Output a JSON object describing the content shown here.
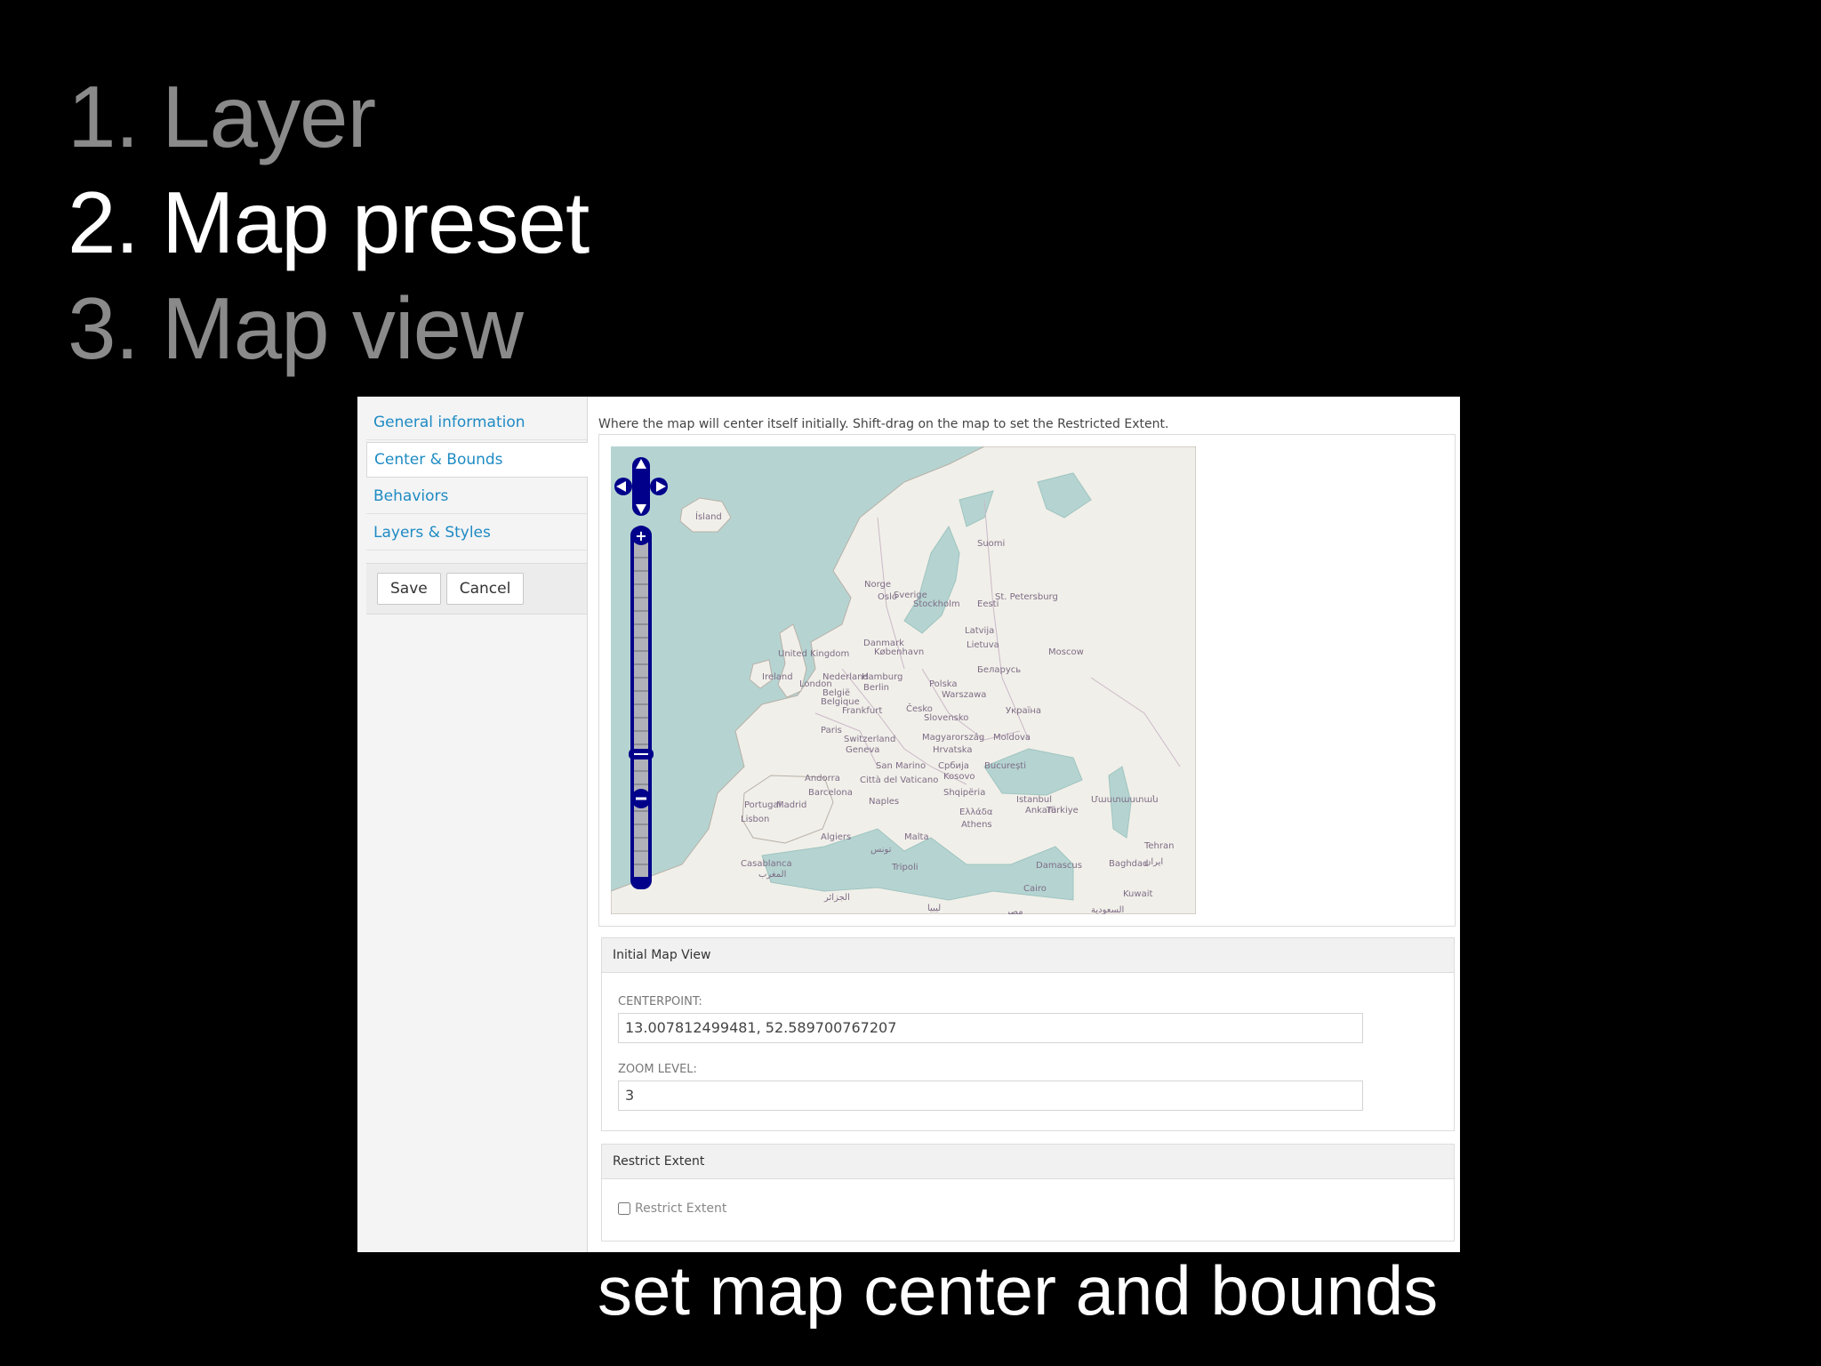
{
  "slide": {
    "steps": [
      "1. Layer",
      "2. Map preset",
      "3. Map view"
    ],
    "active_step": 1,
    "caption": "set map center and bounds"
  },
  "sidebar": {
    "tabs": [
      "General information",
      "Center & Bounds",
      "Behaviors",
      "Layers & Styles"
    ],
    "selected_tab": 1,
    "save_label": "Save",
    "cancel_label": "Cancel"
  },
  "main": {
    "description": "Where the map will center itself initially. Shift-drag on the map to set the Restricted Extent.",
    "map": {
      "controls": [
        "pan-control",
        "zoom-bar"
      ],
      "labels": [
        "Ísland",
        "Suomi",
        "Norge",
        "Sverige",
        "Oslo",
        "Stockholm",
        "Eesti",
        "St. Petersburg",
        "Latvija",
        "Lietuva",
        "Danmark",
        "København",
        "United Kingdom",
        "Ireland",
        "London",
        "Nederland",
        "Hamburg",
        "Berlin",
        "Polska",
        "Warszawa",
        "Беларусь",
        "Moscow",
        "België",
        "Belgique",
        "Frankfurt",
        "Česko",
        "Україна",
        "Slovensko",
        "Paris",
        "Magyarország",
        "Moldova",
        "Switzerland",
        "Geneva",
        "Hrvatska",
        "San Marino",
        "Србија",
        "București",
        "Kosovo",
        "Andorra",
        "Città del Vaticano",
        "Barcelona",
        "Naples",
        "Shqipëria",
        "Portugal",
        "Madrid",
        "Lisbon",
        "Istanbul",
        "Türkiye",
        "Ελλάδα",
        "Athens",
        "Ankara",
        "Algiers",
        "Malta",
        "Tehran",
        "تونس",
        "Casablanca",
        "المغرب",
        "Tripoli",
        "Damascus",
        "Baghdad",
        "Cairo",
        "Kuwait",
        "الجزائر",
        "ليبيا",
        "مصر",
        "السعودية",
        "ایران",
        "Մաստաստան"
      ]
    },
    "initial_view": {
      "legend": "Initial Map View",
      "centerpoint_label": "Centerpoint:",
      "centerpoint_value": "13.007812499481, 52.589700767207",
      "zoom_label": "Zoom Level:",
      "zoom_value": "3"
    },
    "restrict": {
      "legend": "Restrict Extent",
      "checkbox_label": "Restrict Extent",
      "checked": false
    }
  },
  "colors": {
    "link": "#1e8bc3",
    "water": "#b5d4d1",
    "land": "#f1efe9",
    "control": "#00008b"
  }
}
